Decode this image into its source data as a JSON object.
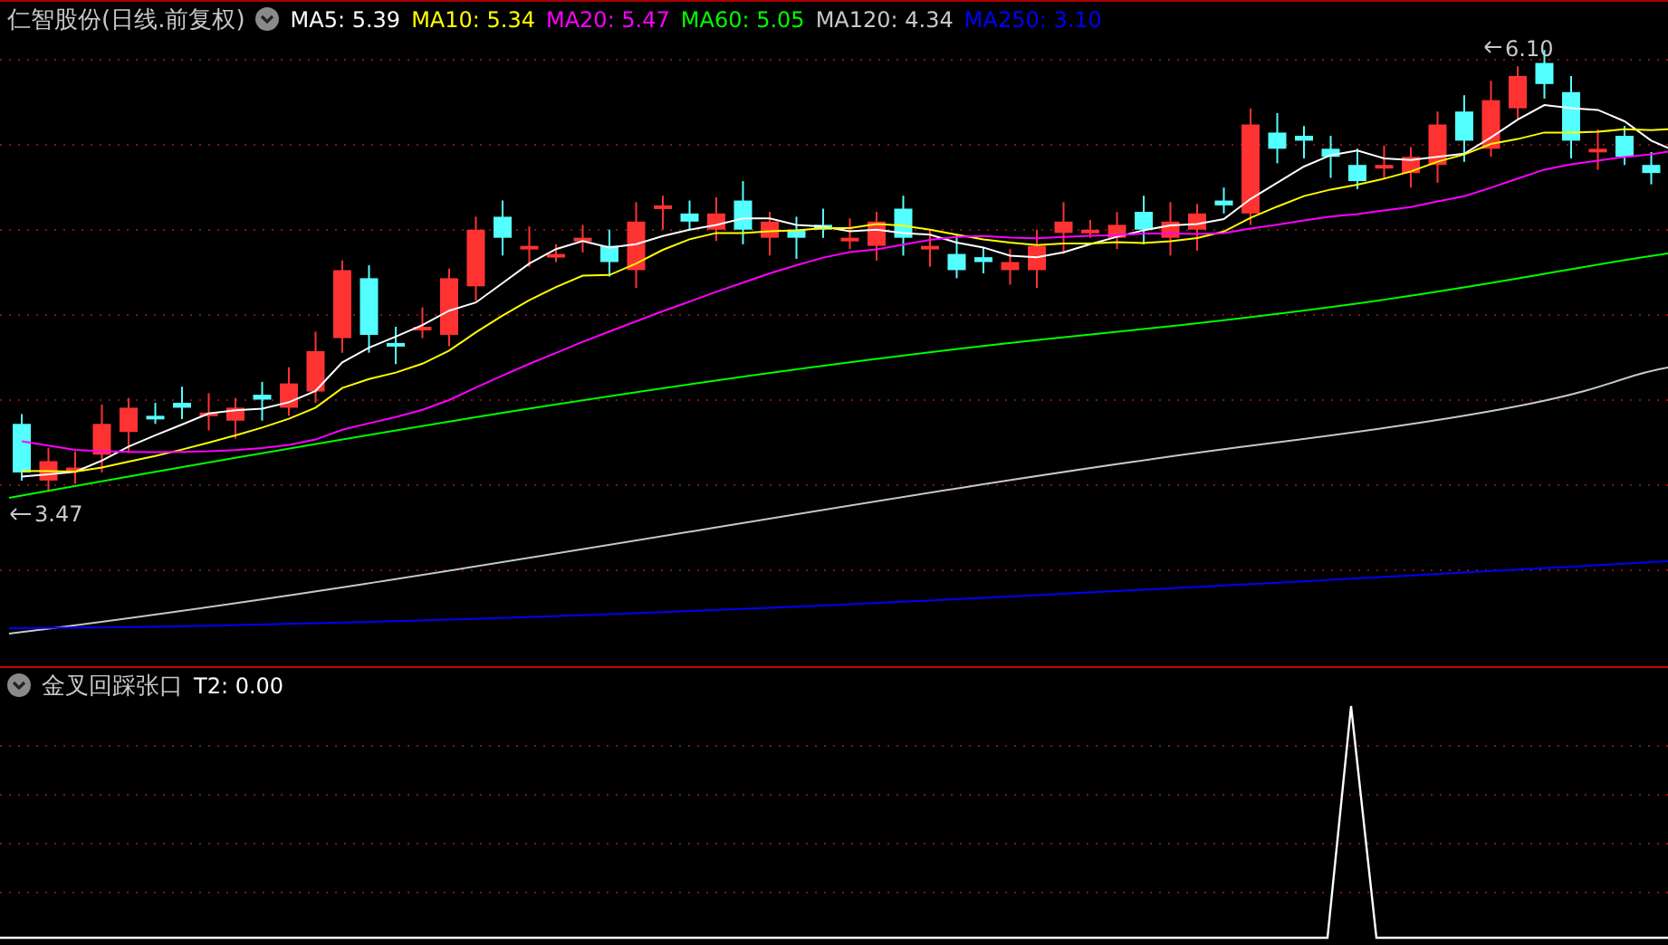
{
  "header": {
    "title": "仁智股份(日线.前复权)",
    "legend": [
      {
        "label": "MA5: 5.39",
        "color": "#ffffff"
      },
      {
        "label": "MA10: 5.34",
        "color": "#ffff00"
      },
      {
        "label": "MA20: 5.47",
        "color": "#ff00ff"
      },
      {
        "label": "MA60: 5.05",
        "color": "#00ff00"
      },
      {
        "label": "MA120: 4.34",
        "color": "#c8c8c8"
      },
      {
        "label": "MA250: 3.10",
        "color": "#0000ff"
      }
    ]
  },
  "main_chart": {
    "high_label": "6.10",
    "low_label": "3.47"
  },
  "indicator": {
    "title": "金叉回踩张口",
    "legend": [
      {
        "label": "T2: 0.00",
        "color": "#ffffff"
      }
    ]
  }
}
